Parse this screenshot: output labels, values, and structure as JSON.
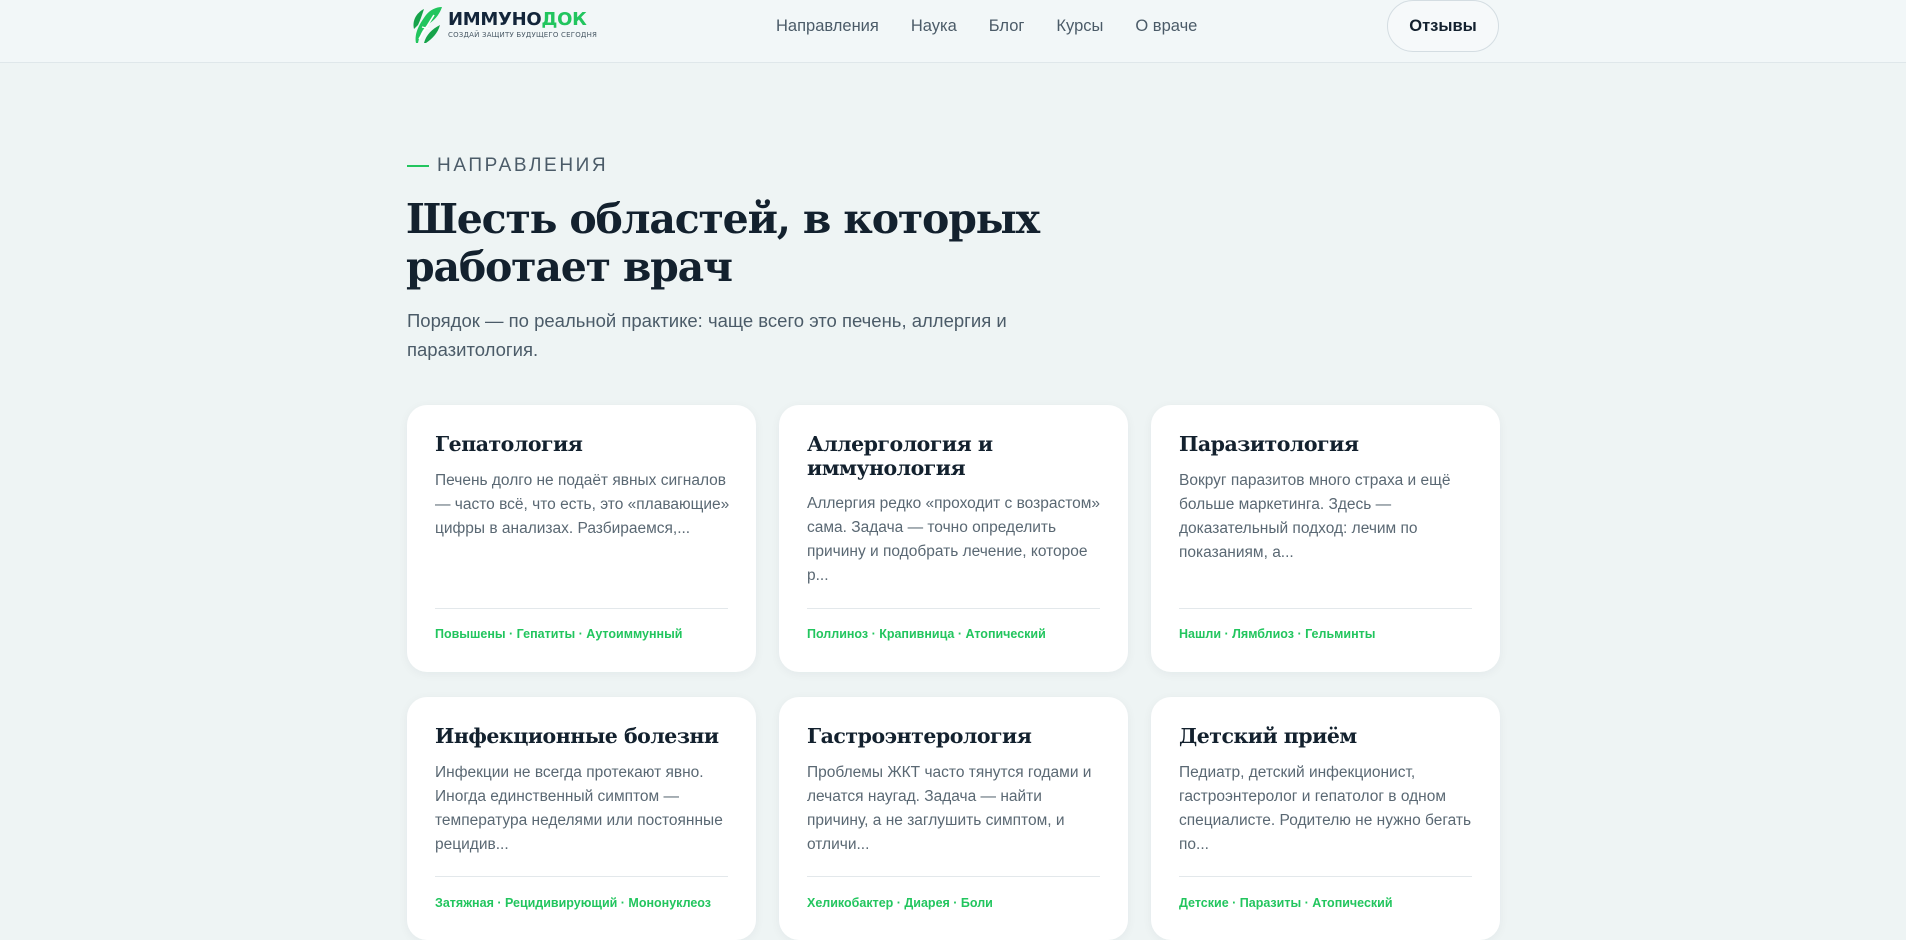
{
  "header": {
    "logo": {
      "name_part1": "ИММУНО",
      "name_part2": "ДОК",
      "tagline": "СОЗДАЙ ЗАЩИТУ БУДУЩЕГО СЕГОДНЯ"
    },
    "nav": [
      "Направления",
      "Наука",
      "Блог",
      "Курсы",
      "О враче"
    ],
    "reviews_button": "Отзывы"
  },
  "section": {
    "eyebrow": "НАПРАВЛЕНИЯ",
    "title_line1": "Шесть областей, в которых",
    "title_line2": "работает врач",
    "subtitle": "Порядок — по реальной практике: чаще всего это печень, аллергия и паразитология."
  },
  "cards": [
    {
      "title": "Гепатология",
      "desc": "Печень долго не подаёт явных сигналов — часто всё, что есть, это «плавающие» цифры в анализах. Разбираемся,...",
      "tags": "Повышены · Гепатиты · Аутоиммунный"
    },
    {
      "title": "Аллергология и иммунология",
      "desc": "Аллергия редко «проходит с возрастом» сама. Задача — точно определить причину и подобрать лечение, которое р...",
      "tags": "Поллиноз · Крапивница · Атопический"
    },
    {
      "title": "Паразитология",
      "desc": "Вокруг паразитов много страха и ещё больше маркетинга. Здесь — доказательный подход: лечим по показаниям, а...",
      "tags": "Нашли · Лямблиоз · Гельминты"
    },
    {
      "title": "Инфекционные болезни",
      "desc": "Инфекции не всегда протекают явно. Иногда единственный симптом — температура неделями или постоянные рецидив...",
      "tags": "Затяжная · Рецидивирующий · Мононуклеоз"
    },
    {
      "title": "Гастроэнтерология",
      "desc": "Проблемы ЖКТ часто тянутся годами и лечатся наугад. Задача — найти причину, а не заглушить симптом, и отличи...",
      "tags": "Хеликобактер · Диарея · Боли"
    },
    {
      "title": "Детский приём",
      "desc": "Педиатр, детский инфекционист, гастроэнтеролог и гепатолог в одном специалисте. Родителю не нужно бегать по...",
      "tags": "Детские · Паразиты · Атопический"
    }
  ],
  "colors": {
    "accent": "#22c55e",
    "dark": "#13212e",
    "muted": "#5a6873",
    "background": "#eef4f4"
  }
}
